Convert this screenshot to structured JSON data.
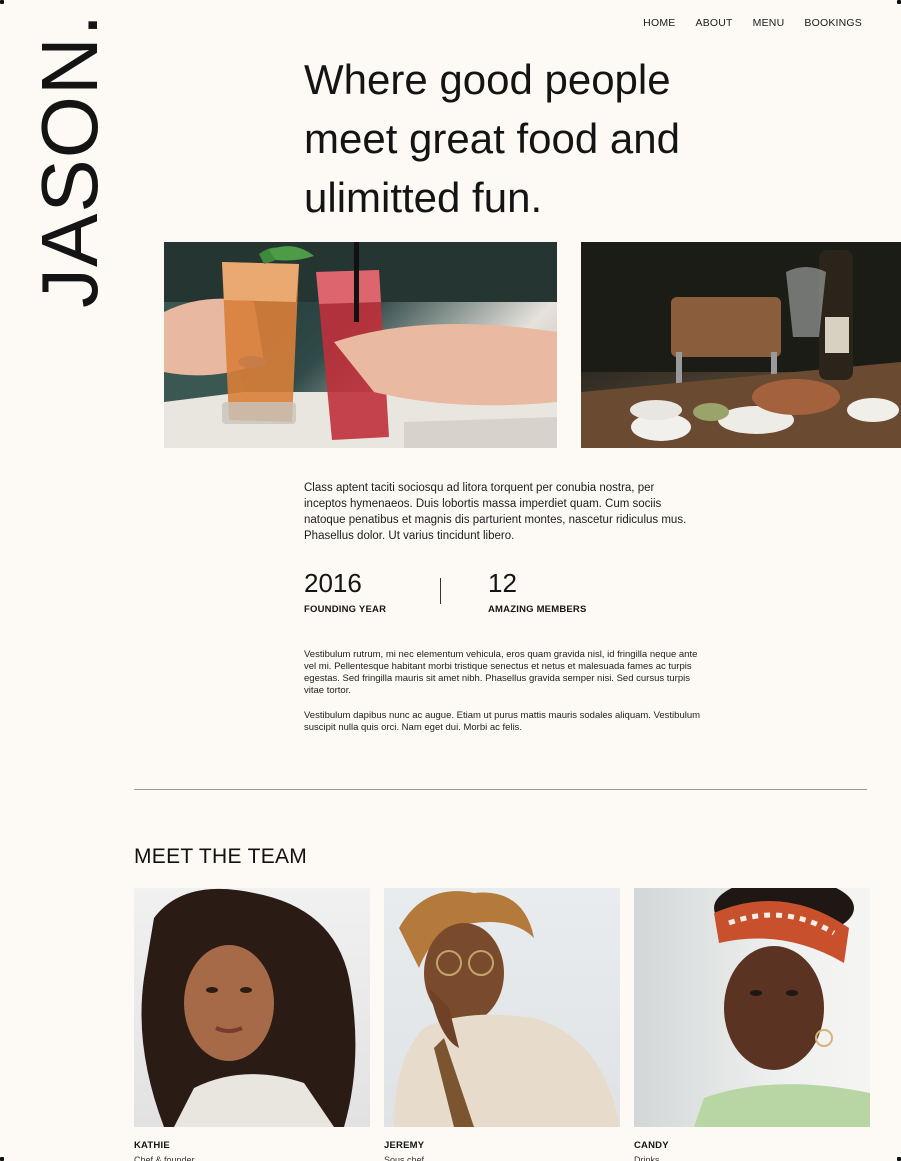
{
  "brand": {
    "logo": "JASON."
  },
  "nav": {
    "items": [
      {
        "label": "HOME"
      },
      {
        "label": "ABOUT"
      },
      {
        "label": "MENU"
      },
      {
        "label": "BOOKINGS"
      }
    ]
  },
  "hero": {
    "headline": "Where good people meet great food and ulimitted fun."
  },
  "images": [
    {
      "name": "cocktails-toast-photo"
    },
    {
      "name": "restaurant-table-photo"
    }
  ],
  "about": {
    "intro": "Class aptent taciti sociosqu ad litora torquent per conubia nostra, per inceptos hymenaeos. Duis lobortis massa imperdiet quam. Cum sociis natoque penatibus et magnis dis parturient montes, nascetur ridiculus mus. Phasellus dolor. Ut varius tincidunt libero.",
    "stats": [
      {
        "value": "2016",
        "label": "FOUNDING YEAR"
      },
      {
        "value": "12",
        "label": "AMAZING MEMBERS"
      }
    ],
    "paragraphs": [
      "Vestibulum rutrum, mi nec elementum vehicula, eros quam gravida nisl, id fringilla neque ante vel mi. Pellentesque habitant morbi tristique senectus et netus et malesuada fames ac turpis egestas. Sed fringilla mauris sit amet nibh. Phasellus gravida semper nisi. Sed cursus turpis vitae tortor.",
      "Vestibulum dapibus nunc ac augue. Etiam ut purus mattis mauris sodales aliquam. Vestibulum suscipit nulla quis orci. Nam eget dui. Morbi ac felis."
    ]
  },
  "team": {
    "title": "MEET THE TEAM",
    "members": [
      {
        "name": "KATHIE",
        "role": "Chef & founder"
      },
      {
        "name": "JEREMY",
        "role": "Sous chef"
      },
      {
        "name": "CANDY",
        "role": "Drinks"
      }
    ]
  }
}
